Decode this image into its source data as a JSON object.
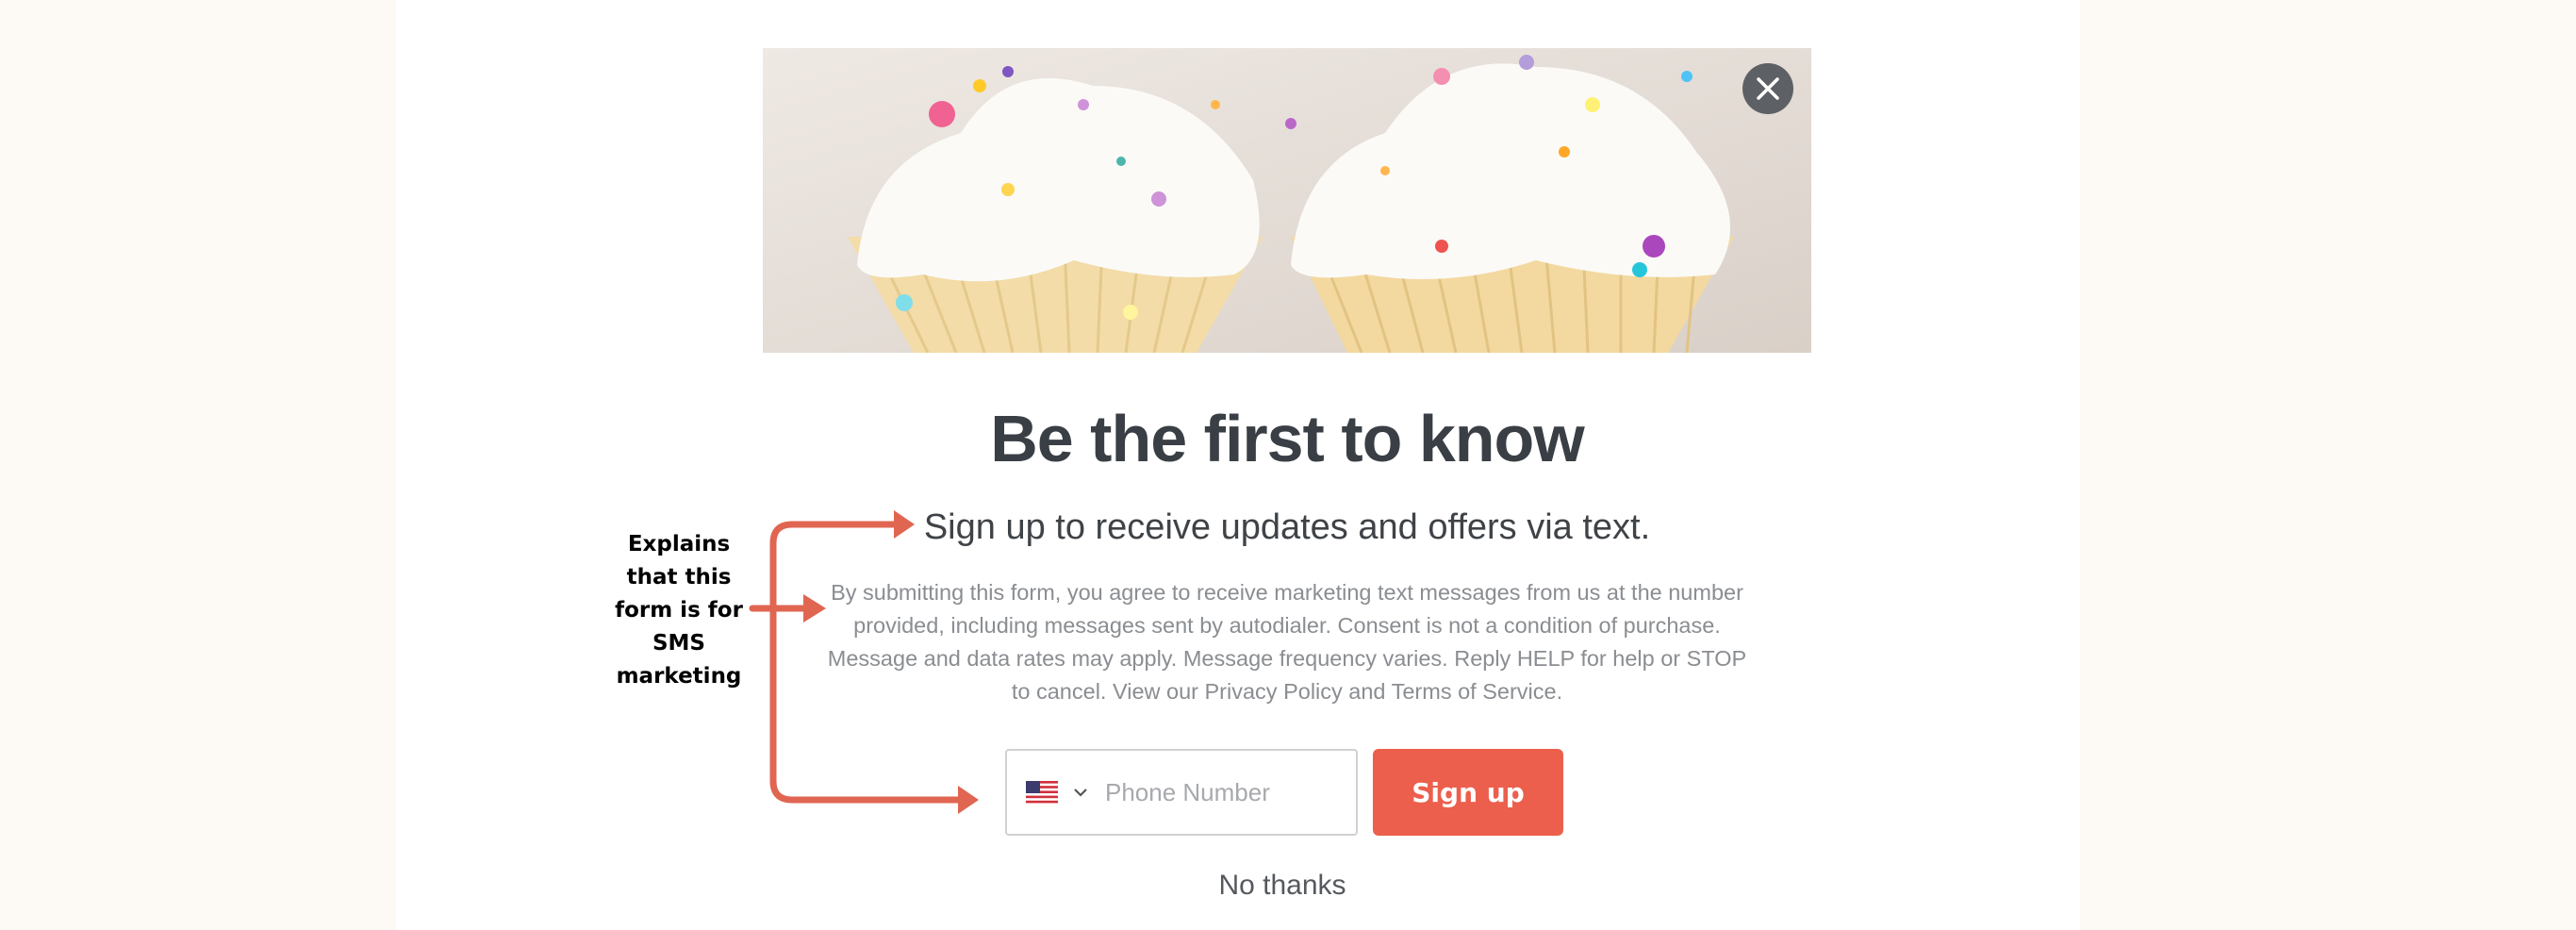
{
  "popup": {
    "headline": "Be the first to know",
    "subheadline": "Sign up to receive updates and offers via text.",
    "legal": "By submitting this form, you agree to receive marketing text messages from us at the number provided, including messages sent by autodialer. Consent is not a condition of purchase. Message and data rates may apply. Message frequency varies. Reply HELP for help or STOP to cancel. View our Privacy Policy and Terms of Service.",
    "phone": {
      "placeholder": "Phone Number",
      "value": "",
      "country_icon": "us-flag-icon",
      "dropdown_icon": "chevron-down-icon"
    },
    "signup_label": "Sign up",
    "no_thanks_label": "No thanks",
    "close_icon": "close-icon",
    "hero_image": "cupcakes-with-frosting-and-sprinkles"
  },
  "annotation": {
    "lines": [
      "Explains",
      "that this",
      "form is for",
      "SMS",
      "marketing"
    ]
  },
  "colors": {
    "accent": "#ec5f4d",
    "arrow": "#e06652",
    "headline": "#3a3f45",
    "page_background": "#fdf9f5"
  }
}
